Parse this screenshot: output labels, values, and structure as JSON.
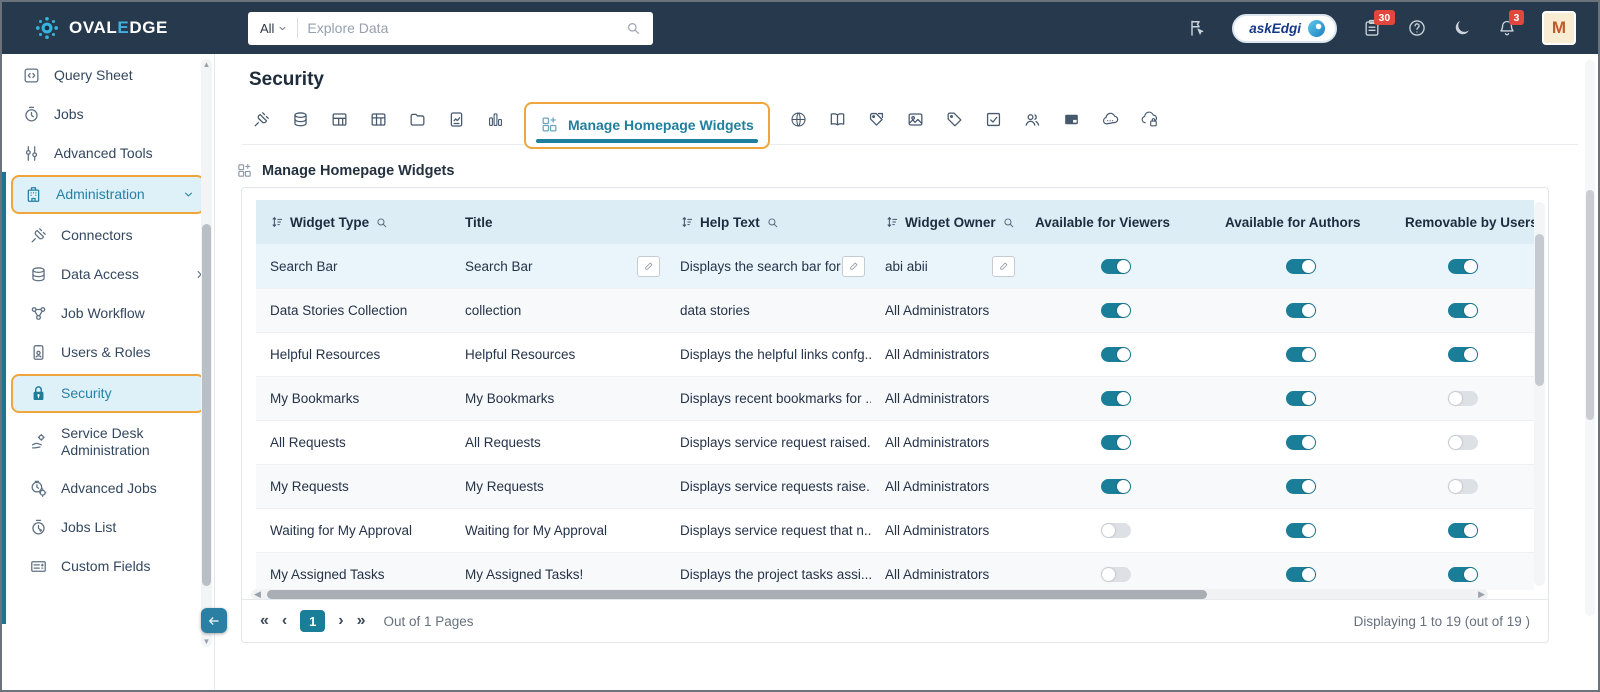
{
  "topbar": {
    "brand": {
      "prefix": "OVAL",
      "accent": "E",
      "suffix": "DGE"
    },
    "search": {
      "scope": "All",
      "placeholder": "Explore Data"
    },
    "askedgi_label": "askEdgi",
    "badges": {
      "clipboard": "30",
      "notifications": "3"
    },
    "avatar_initial": "M"
  },
  "sidebar": {
    "items": [
      {
        "label": "Query Sheet",
        "icon": "query-sheet-icon"
      },
      {
        "label": "Jobs",
        "icon": "jobs-icon"
      },
      {
        "label": "Advanced Tools",
        "icon": "advanced-tools-icon"
      },
      {
        "label": "Administration",
        "icon": "administration-icon",
        "active": true,
        "chevron": "down"
      },
      {
        "label": "Connectors",
        "icon": "connectors-icon",
        "child": true
      },
      {
        "label": "Data Access",
        "icon": "data-access-icon",
        "child": true,
        "chevron": "right"
      },
      {
        "label": "Job Workflow",
        "icon": "job-workflow-icon",
        "child": true
      },
      {
        "label": "Users & Roles",
        "icon": "users-roles-icon",
        "child": true
      },
      {
        "label": "Security",
        "icon": "security-icon",
        "child": true,
        "active": true
      },
      {
        "label": "Service Desk Administration",
        "icon": "service-desk-icon",
        "child": true
      },
      {
        "label": "Advanced Jobs",
        "icon": "advanced-jobs-icon",
        "child": true
      },
      {
        "label": "Jobs List",
        "icon": "jobs-list-icon",
        "child": true
      },
      {
        "label": "Custom Fields",
        "icon": "custom-fields-icon",
        "child": true
      }
    ]
  },
  "main": {
    "page_title": "Security",
    "section_title": "Manage Homepage Widgets"
  },
  "tabs": [
    {
      "icon": "crawler-icon"
    },
    {
      "icon": "database-icon"
    },
    {
      "icon": "table-icon"
    },
    {
      "icon": "table-columns-icon"
    },
    {
      "icon": "folder-icon"
    },
    {
      "icon": "report-icon"
    },
    {
      "icon": "chart-icon"
    },
    {
      "icon": "widgets-icon",
      "label": "Manage Homepage Widgets",
      "active": true
    },
    {
      "icon": "globe-icon"
    },
    {
      "icon": "book-icon"
    },
    {
      "icon": "tag-document-icon"
    },
    {
      "icon": "image-icon"
    },
    {
      "icon": "tag-icon"
    },
    {
      "icon": "checkbox-icon"
    },
    {
      "icon": "users-icon"
    },
    {
      "icon": "panel-icon"
    },
    {
      "icon": "cloud-api-icon"
    },
    {
      "icon": "cloud-api-lock-icon"
    }
  ],
  "table": {
    "columns": [
      {
        "label": "Widget Type",
        "sortable": true,
        "searchable": true
      },
      {
        "label": "Title",
        "sortable": false,
        "searchable": false
      },
      {
        "label": "Help Text",
        "sortable": true,
        "searchable": true
      },
      {
        "label": "Widget Owner",
        "sortable": true,
        "searchable": true
      },
      {
        "label": "Available for Viewers",
        "sortable": false,
        "searchable": false
      },
      {
        "label": "Available for Authors",
        "sortable": false,
        "searchable": false
      },
      {
        "label": "Removable by Users",
        "sortable": false,
        "searchable": false
      }
    ],
    "rows": [
      {
        "widget_type": "Search Bar",
        "title": "Search Bar",
        "help_text": "Displays the search bar for qui...",
        "widget_owner": "abi abii",
        "viewers": true,
        "authors": true,
        "removable": true,
        "selected": true,
        "editable": true
      },
      {
        "widget_type": "Data Stories Collection",
        "title": "collection",
        "help_text": "data stories",
        "widget_owner": "All Administrators",
        "viewers": true,
        "authors": true,
        "removable": true
      },
      {
        "widget_type": "Helpful Resources",
        "title": "Helpful Resources",
        "help_text": "Displays the helpful links confg...",
        "widget_owner": "All Administrators",
        "viewers": true,
        "authors": true,
        "removable": true
      },
      {
        "widget_type": "My Bookmarks",
        "title": "My Bookmarks",
        "help_text": "Displays recent bookmarks for ...",
        "widget_owner": "All Administrators",
        "viewers": true,
        "authors": true,
        "removable": false
      },
      {
        "widget_type": "All Requests",
        "title": "All Requests",
        "help_text": "Displays service request raised...",
        "widget_owner": "All Administrators",
        "viewers": true,
        "authors": true,
        "removable": false
      },
      {
        "widget_type": "My Requests",
        "title": "My Requests",
        "help_text": "Displays service requests raise...",
        "widget_owner": "All Administrators",
        "viewers": true,
        "authors": true,
        "removable": false
      },
      {
        "widget_type": "Waiting for My Approval",
        "title": "Waiting for My Approval",
        "help_text": "Displays service request that n...",
        "widget_owner": "All Administrators",
        "viewers": false,
        "authors": true,
        "removable": true
      },
      {
        "widget_type": "My Assigned Tasks",
        "title": "My Assigned Tasks!",
        "help_text": "Displays the project tasks assi...",
        "widget_owner": "All Administrators",
        "viewers": false,
        "authors": true,
        "removable": true
      }
    ]
  },
  "pagination": {
    "first": "«",
    "prev": "‹",
    "page": "1",
    "next": "›",
    "last": "»",
    "out_of": "Out of 1 Pages",
    "summary": "Displaying 1 to 19  (out of 19 )"
  },
  "icons": {
    "search-icon": "magnifier",
    "moon-icon": "☾",
    "bell-icon": "bell",
    "help-icon": "?",
    "clipboard-icon": "clipboard",
    "bookmark-flag-icon": "flag",
    "sort-icon": "⇅",
    "pencil-icon": "✎",
    "chevron-down-icon": "⌄",
    "chevron-right-icon": "›",
    "collapse-left-icon": "←",
    "scroll-up-icon": "▲",
    "scroll-down-icon": "▼"
  }
}
